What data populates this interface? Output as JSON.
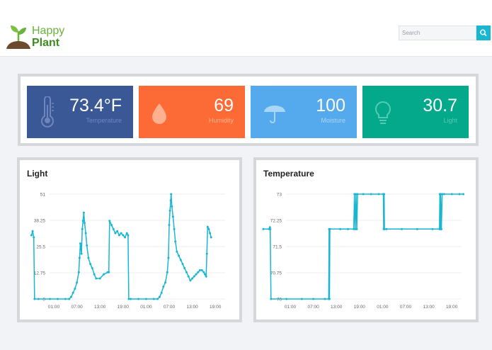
{
  "header": {
    "brand_line1": "Happy",
    "brand_line2": "Plant",
    "search_placeholder": "Search",
    "logo_icon": "sprout-icon",
    "search_icon": "search-icon"
  },
  "stats": [
    {
      "value": "73.4°F",
      "label": "Temperature",
      "color": "#3b5896",
      "label_color": "#6e86bd",
      "icon": "thermometer-icon"
    },
    {
      "value": "69",
      "label": "Humidity",
      "color": "#fc6a35",
      "label_color": "#ffb08f",
      "icon": "droplet-icon"
    },
    {
      "value": "100",
      "label": "Moisture",
      "color": "#55aaed",
      "label_color": "#a9d5f6",
      "icon": "umbrella-icon"
    },
    {
      "value": "30.7",
      "label": "Light",
      "color": "#04a88a",
      "label_color": "#52cbb3",
      "icon": "lightbulb-icon"
    }
  ],
  "accent": "#19b6d2",
  "chart_data": [
    {
      "type": "line",
      "title": "Light",
      "xlabel": "",
      "ylabel": "",
      "ylim": [
        0,
        51
      ],
      "y_ticks": [
        "0",
        "12.75",
        "25.5",
        "38.25",
        "51"
      ],
      "x_ticks": [
        "01:00",
        "07:00",
        "13:00",
        "19:00",
        "01:00",
        "07:00",
        "13:00",
        "19:00"
      ],
      "grid": true,
      "series": [
        {
          "color": "#19b6d2",
          "points": [
            [
              -4.8,
              31
            ],
            [
              -4.5,
              33
            ],
            [
              -4.2,
              30
            ],
            [
              -4,
              0
            ],
            [
              -3,
              0
            ],
            [
              0,
              0
            ],
            [
              2,
              0
            ],
            [
              4,
              0
            ],
            [
              5,
              0
            ],
            [
              5.5,
              1
            ],
            [
              6,
              3
            ],
            [
              6.5,
              5
            ],
            [
              7,
              8
            ],
            [
              7.5,
              13
            ],
            [
              7.7,
              20
            ],
            [
              7.9,
              27
            ],
            [
              8,
              26
            ],
            [
              8.2,
              22
            ],
            [
              8.4,
              34
            ],
            [
              8.6,
              38
            ],
            [
              8.8,
              42
            ],
            [
              9,
              37
            ],
            [
              9.3,
              32
            ],
            [
              9.6,
              26
            ],
            [
              10,
              20
            ],
            [
              10.5,
              17
            ],
            [
              11,
              15
            ],
            [
              11.5,
              12
            ],
            [
              12,
              10
            ],
            [
              13,
              10
            ],
            [
              14,
              12
            ],
            [
              15,
              13
            ],
            [
              15.3,
              13
            ],
            [
              15.5,
              38
            ],
            [
              16,
              36
            ],
            [
              16.5,
              34
            ],
            [
              17,
              32
            ],
            [
              17.5,
              33
            ],
            [
              18,
              31
            ],
            [
              18.5,
              32
            ],
            [
              19,
              31
            ],
            [
              19.5,
              30
            ],
            [
              20,
              32
            ],
            [
              20.3,
              31
            ],
            [
              20.5,
              0
            ],
            [
              21,
              0
            ],
            [
              23,
              0
            ],
            [
              25,
              0
            ],
            [
              27,
              0
            ],
            [
              28,
              0
            ],
            [
              28.5,
              1
            ],
            [
              29,
              3
            ],
            [
              29.5,
              6
            ],
            [
              30,
              8
            ],
            [
              30.5,
              13
            ],
            [
              30.8,
              20
            ],
            [
              31,
              36
            ],
            [
              31.2,
              43
            ],
            [
              31.4,
              48
            ],
            [
              31.5,
              51
            ],
            [
              31.7,
              45
            ],
            [
              32,
              40
            ],
            [
              32.3,
              34
            ],
            [
              32.6,
              28
            ],
            [
              33,
              23
            ],
            [
              33.5,
              21
            ],
            [
              34,
              19
            ],
            [
              34.5,
              17
            ],
            [
              35,
              15
            ],
            [
              35.5,
              13
            ],
            [
              36,
              11
            ],
            [
              36.5,
              9
            ],
            [
              37,
              10
            ],
            [
              37.5,
              11
            ],
            [
              38,
              12
            ],
            [
              38.5,
              13
            ],
            [
              39,
              14
            ],
            [
              39.5,
              14
            ],
            [
              40,
              13
            ],
            [
              40.3,
              12
            ],
            [
              40.6,
              11
            ],
            [
              40.8,
              22
            ],
            [
              41,
              35
            ],
            [
              41.3,
              34
            ],
            [
              41.6,
              32
            ],
            [
              41.9,
              30
            ]
          ]
        }
      ]
    },
    {
      "type": "line",
      "title": "Temperature",
      "xlabel": "",
      "ylabel": "",
      "ylim": [
        70,
        73
      ],
      "y_ticks": [
        "70",
        "70.75",
        "71.5",
        "72.25",
        "73"
      ],
      "x_ticks": [
        "01:00",
        "07:00",
        "13:00",
        "19:00",
        "01:00",
        "07:00",
        "13:00",
        "19:00"
      ],
      "grid": true,
      "series": [
        {
          "color": "#19b6d2",
          "points": [
            [
              -6,
              72
            ],
            [
              -4.5,
              72
            ],
            [
              -4.3,
              72.05
            ],
            [
              -4.2,
              72
            ],
            [
              -4,
              70
            ],
            [
              0,
              70
            ],
            [
              4,
              70
            ],
            [
              7,
              70
            ],
            [
              10,
              70
            ],
            [
              11,
              70
            ],
            [
              11.1,
              72
            ],
            [
              11.2,
              70
            ],
            [
              11.3,
              72
            ],
            [
              14,
              72
            ],
            [
              16,
              72
            ],
            [
              17.5,
              72
            ],
            [
              17.7,
              73
            ],
            [
              17.9,
              72
            ],
            [
              18.1,
              73
            ],
            [
              18.3,
              72
            ],
            [
              18.5,
              73
            ],
            [
              20,
              73
            ],
            [
              22,
              73
            ],
            [
              24,
              73
            ],
            [
              25.2,
              73
            ],
            [
              25.3,
              72
            ],
            [
              25.4,
              73
            ],
            [
              25.5,
              72
            ],
            [
              26,
              72
            ],
            [
              30,
              72
            ],
            [
              34,
              72
            ],
            [
              38,
              72
            ],
            [
              39.8,
              72
            ],
            [
              39.9,
              73
            ],
            [
              40,
              72
            ],
            [
              40.1,
              73
            ],
            [
              40.3,
              72
            ],
            [
              40.5,
              73
            ],
            [
              41,
              73
            ],
            [
              43,
              73
            ],
            [
              45,
              73
            ],
            [
              46,
              73
            ]
          ]
        }
      ]
    }
  ]
}
